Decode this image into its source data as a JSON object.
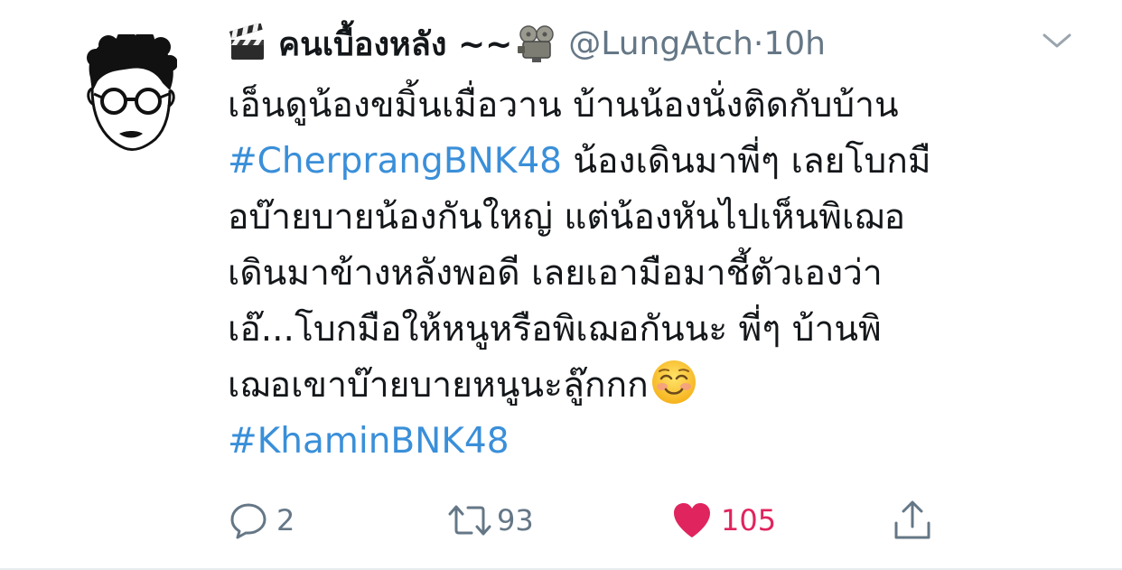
{
  "tweet": {
    "display_name": "คนเบื้องหลัง ~~",
    "handle": "@LungAtch",
    "separator": "·",
    "time": "10h",
    "lines": [
      {
        "parts": [
          {
            "text": "เอ็นดูน้องขมิ้นเมื่อวาน บ้านน้องนั่งติดกับบ้าน",
            "hashtag": false
          }
        ]
      },
      {
        "parts": [
          {
            "text": "#CherprangBNK48",
            "hashtag": true
          },
          {
            "text": " น้องเดินมาพี่ๆ เลยโบกมื",
            "hashtag": false
          }
        ]
      },
      {
        "parts": [
          {
            "text": "อบ๊ายบายน้องกันใหญ่ แต่น้องหันไปเห็นพิเฌอ",
            "hashtag": false
          }
        ]
      },
      {
        "parts": [
          {
            "text": "เดินมาข้างหลังพอดี เลยเอามือมาชี้ตัวเองว่า",
            "hashtag": false
          }
        ]
      },
      {
        "parts": [
          {
            "text": "เอ๊...โบกมือให้หนูหรือพิเฌอกันนะ พี่ๆ บ้านพิ",
            "hashtag": false
          }
        ]
      },
      {
        "parts": [
          {
            "text": "เฌอเขาบ๊ายบายหนูนะลู๊กกก",
            "hashtag": false
          }
        ]
      },
      {
        "parts": [
          {
            "text": "#KhaminBNK48",
            "hashtag": true
          }
        ]
      }
    ],
    "emoji": {
      "name_left": "clapper-board",
      "name_right": "film-projector",
      "end_of_text": "smiling-face"
    },
    "actions": {
      "replies": "2",
      "retweets": "93",
      "likes": "105"
    },
    "colors": {
      "hashtag": "#3a8fd9",
      "like": "#e0245e",
      "muted": "#657786"
    }
  }
}
